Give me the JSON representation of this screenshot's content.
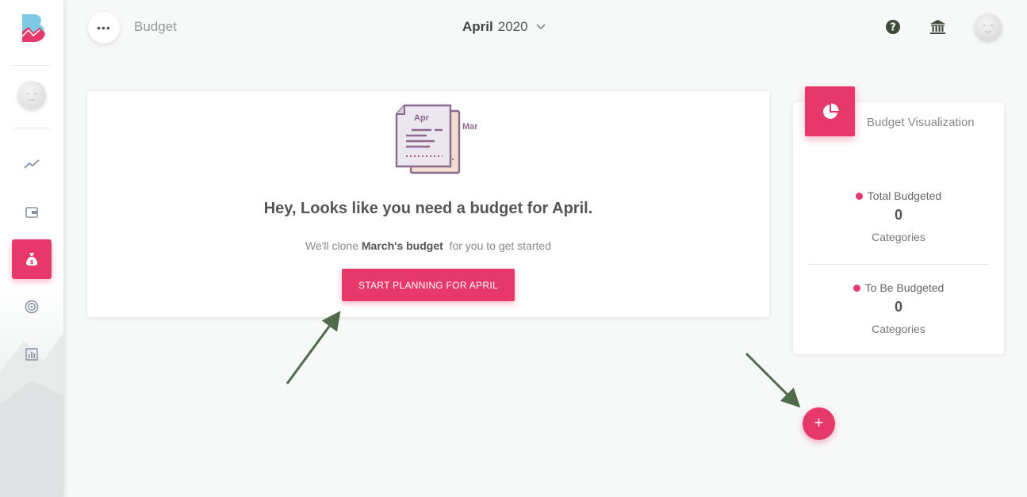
{
  "header": {
    "page_title": "Budget",
    "month": "April",
    "year": "2020",
    "help_icon": "help-circle-icon",
    "bank_icon": "bank-icon"
  },
  "sidebar": {
    "items": [
      {
        "name": "trends",
        "icon": "trend-line-icon",
        "active": false
      },
      {
        "name": "wallet",
        "icon": "wallet-icon",
        "active": false
      },
      {
        "name": "budget",
        "icon": "money-bag-icon",
        "active": true
      },
      {
        "name": "goals",
        "icon": "target-icon",
        "active": false
      },
      {
        "name": "reports",
        "icon": "bar-chart-icon",
        "active": false
      }
    ]
  },
  "main": {
    "illustration": {
      "front_label": "Apr",
      "back_label": "Mar"
    },
    "heading": "Hey, Looks like you need a budget for April.",
    "sub_prefix": "We'll clone ",
    "sub_strong": "March's budget",
    "sub_suffix": "  for you to get started",
    "button_label": "START PLANNING FOR APRIL"
  },
  "visualization": {
    "title": "Budget Visualization",
    "stats": [
      {
        "label": "Total Budgeted",
        "value": "0",
        "unit": "Categories"
      },
      {
        "label": "To Be Budgeted",
        "value": "0",
        "unit": "Categories"
      }
    ]
  },
  "fab": {
    "label": "+"
  },
  "colors": {
    "accent": "#e6386b",
    "annotation_arrow": "#4f6b4a",
    "background": "#f7f8f8"
  }
}
